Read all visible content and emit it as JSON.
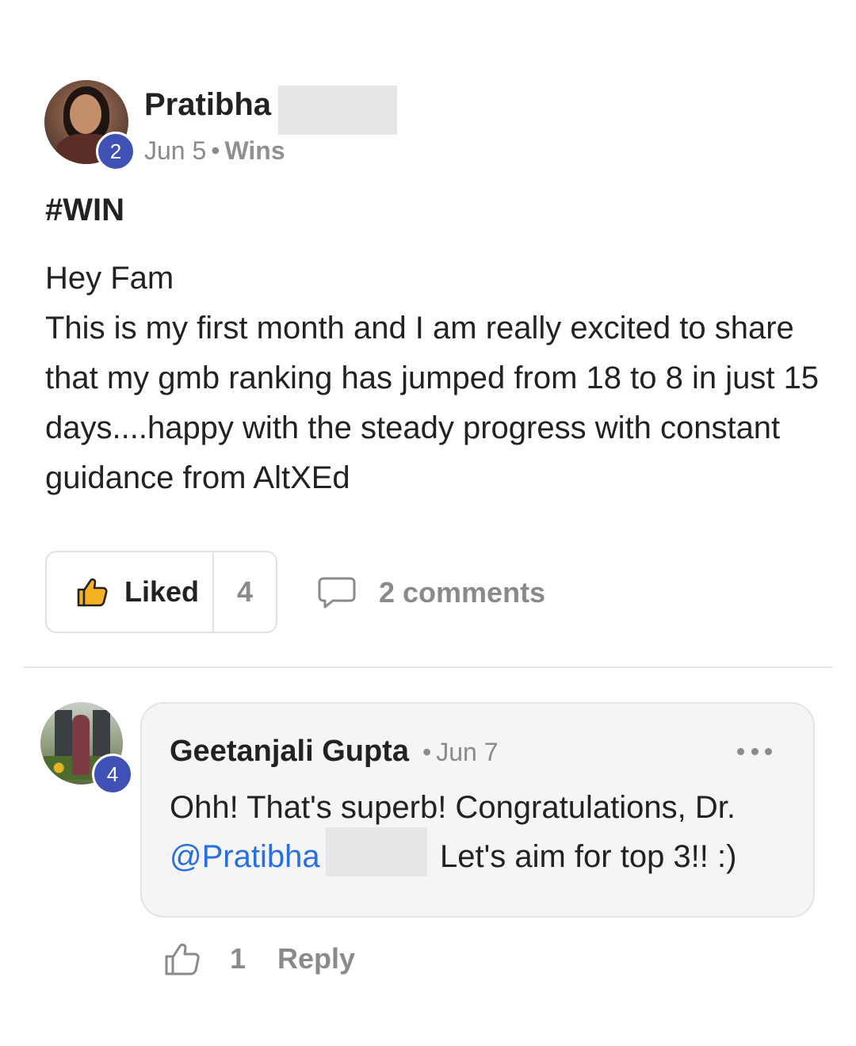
{
  "post": {
    "author_name": "Pratibha",
    "author_level": "2",
    "date": "Jun 5",
    "separator": "•",
    "category": "Wins",
    "title": "#WIN",
    "body_lines": [
      "Hey Fam",
      "This is my first month and I am really excited to share that my gmb ranking has jumped from 18 to 8 in just 15 days....happy with the steady progress with constant guidance from AltXEd"
    ],
    "like_label": "Liked",
    "like_count": "4",
    "comments_label": "2 comments",
    "like_icon": "thumbs-up-filled-icon",
    "comments_icon": "speech-bubble-icon"
  },
  "comment": {
    "author_name": "Geetanjali Gupta",
    "author_level": "4",
    "separator": "•",
    "date": "Jun 7",
    "more_icon": "more-horizontal-icon",
    "text_line_1": "Ohh! That's superb! Congratulations, Dr.",
    "mention": "@Pratibha",
    "text_line_2": "Let's aim for top 3!! :)",
    "like_icon": "thumbs-up-outline-icon",
    "like_count": "1",
    "reply_label": "Reply"
  },
  "colors": {
    "badge": "#3f51b5",
    "mention": "#2a6fe0",
    "like_icon_fill": "#f5b324",
    "muted_text": "#8a8a8a"
  }
}
